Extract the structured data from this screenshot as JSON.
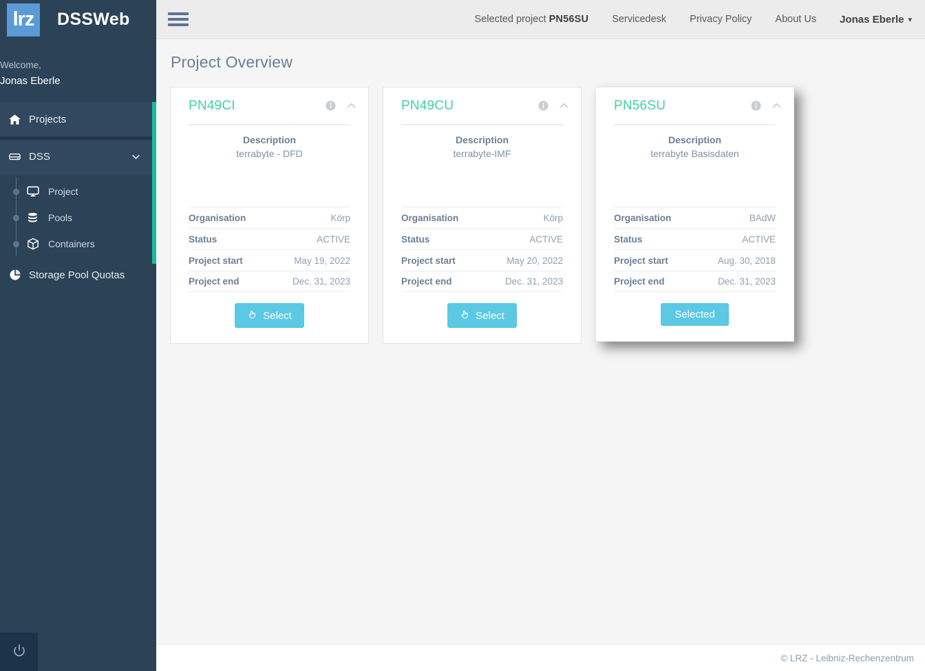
{
  "brand": {
    "logo_text": "lrz",
    "title": "DSSWeb"
  },
  "sidebar": {
    "welcome_label": "Welcome,",
    "user_name": "Jonas Eberle",
    "items": [
      {
        "label": "Projects",
        "icon": "home-icon"
      },
      {
        "label": "DSS",
        "icon": "hard-drive-icon",
        "chevron": "chevron-down-icon"
      }
    ],
    "sub_items": [
      {
        "label": "Project",
        "icon": "monitor-icon"
      },
      {
        "label": "Pools",
        "icon": "database-icon"
      },
      {
        "label": "Containers",
        "icon": "box-icon"
      }
    ],
    "quotas": {
      "label": "Storage Pool Quotas",
      "icon": "pie-chart-icon"
    },
    "power": {
      "icon": "power-icon"
    },
    "accent_color": "#1abc9c",
    "background_color": "#2b4257"
  },
  "topbar": {
    "menu_icon": "hamburger-icon",
    "selected_project_prefix": "Selected project ",
    "selected_project_code": "PN56SU",
    "links": [
      {
        "label": "Servicedesk"
      },
      {
        "label": "Privacy Policy"
      },
      {
        "label": "About Us"
      }
    ],
    "user_menu": {
      "label": "Jonas Eberle",
      "caret": "chevron-down-icon"
    }
  },
  "main": {
    "page_title": "Project Overview",
    "labels": {
      "description": "Description",
      "organisation": "Organisation",
      "status": "Status",
      "project_start": "Project start",
      "project_end": "Project end"
    },
    "cards": [
      {
        "name": "PN49CI",
        "description": "terrabyte - DFD",
        "organisation": "Körp",
        "status": "ACTIVE",
        "project_start": "May 19, 2022",
        "project_end": "Dec. 31, 2023",
        "button_label": "Select",
        "selected": false
      },
      {
        "name": "PN49CU",
        "description": "terrabyte-IMF",
        "organisation": "Körp",
        "status": "ACTIVE",
        "project_start": "May 20, 2022",
        "project_end": "Dec. 31, 2023",
        "button_label": "Select",
        "selected": false
      },
      {
        "name": "PN56SU",
        "description": "terrabyte Basisdaten",
        "organisation": "BAdW",
        "status": "ACTIVE",
        "project_start": "Aug. 30, 2018",
        "project_end": "Dec. 31, 2023",
        "button_label": "Selected",
        "selected": true
      }
    ],
    "card_icons": {
      "info": "info-circle-icon",
      "collapse": "chevron-up-icon"
    },
    "accent_title_color": "#41d1a7",
    "button_color": "#5bc8e4"
  },
  "footer": {
    "copyright": "© LRZ - Leibniz-Rechenzentrum"
  }
}
